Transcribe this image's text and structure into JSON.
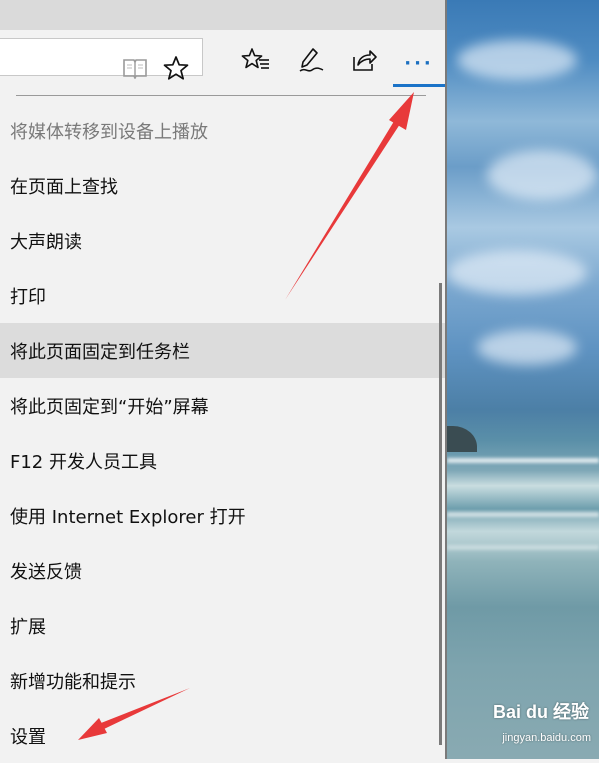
{
  "toolbar": {
    "reading_view_icon": "reading-view-icon",
    "favorite_icon": "star-icon",
    "hub_icon": "hub-icon",
    "note_icon": "pen-icon",
    "share_icon": "share-icon",
    "more_label": "···"
  },
  "menu": {
    "items": [
      {
        "label": "将媒体转移到设备上播放",
        "state": "disabled"
      },
      {
        "label": "在页面上查找",
        "state": "normal"
      },
      {
        "label": "大声朗读",
        "state": "normal"
      },
      {
        "label": "打印",
        "state": "normal"
      },
      {
        "label": "将此页面固定到任务栏",
        "state": "hover"
      },
      {
        "label": "将此页固定到“开始”屏幕",
        "state": "normal"
      },
      {
        "label": "F12 开发人员工具",
        "state": "normal"
      },
      {
        "label": "使用 Internet Explorer 打开",
        "state": "normal"
      },
      {
        "label": "发送反馈",
        "state": "normal"
      },
      {
        "label": "扩展",
        "state": "normal"
      },
      {
        "label": "新增功能和提示",
        "state": "normal"
      },
      {
        "label": "设置",
        "state": "normal"
      }
    ]
  },
  "watermark": {
    "logo_text": "Bai du 经验",
    "url_text": "jingyan.baidu.com"
  },
  "colors": {
    "accent": "#1b73c8",
    "arrow": "#e8393a",
    "menu_bg": "#f2f2f2",
    "hover_bg": "#dcdcdc"
  }
}
